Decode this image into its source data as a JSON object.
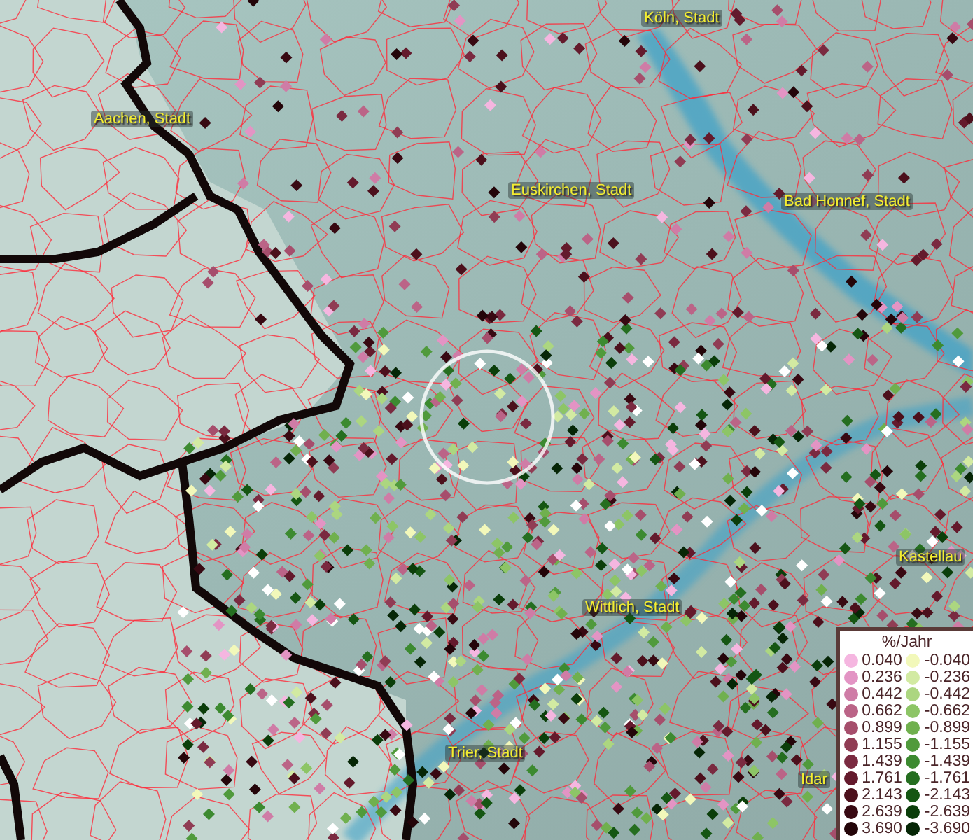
{
  "map": {
    "place_labels": [
      {
        "text": "Köln, Stadt"
      },
      {
        "text": "Aachen, Stadt"
      },
      {
        "text": "Euskirchen, Stadt"
      },
      {
        "text": "Bad Honnef, Stadt"
      },
      {
        "text": "Kastellau"
      },
      {
        "text": "Wittlich, Stadt"
      },
      {
        "text": "Trier, Stadt"
      },
      {
        "text": "Idar"
      }
    ]
  },
  "legend": {
    "title": "%/Jahr",
    "positive": [
      {
        "value": "0.040",
        "color": "#f5b6e0"
      },
      {
        "value": "0.236",
        "color": "#e394c4"
      },
      {
        "value": "0.442",
        "color": "#cf7ca6"
      },
      {
        "value": "0.662",
        "color": "#bb6487"
      },
      {
        "value": "0.899",
        "color": "#a64e6c"
      },
      {
        "value": "1.155",
        "color": "#903c54"
      },
      {
        "value": "1.439",
        "color": "#7a2a40"
      },
      {
        "value": "1.761",
        "color": "#641a2c"
      },
      {
        "value": "2.143",
        "color": "#4c101c"
      },
      {
        "value": "2.639",
        "color": "#380912"
      },
      {
        "value": "3.690",
        "color": "#240509"
      }
    ],
    "negative": [
      {
        "value": "-0.040",
        "color": "#f2f8ba"
      },
      {
        "value": "-0.236",
        "color": "#d2eaa2"
      },
      {
        "value": "-0.442",
        "color": "#acd680"
      },
      {
        "value": "-0.662",
        "color": "#8dc566"
      },
      {
        "value": "-0.899",
        "color": "#70b04e"
      },
      {
        "value": "-1.155",
        "color": "#509a3c"
      },
      {
        "value": "-1.439",
        "color": "#3c8a30"
      },
      {
        "value": "-1.761",
        "color": "#256e20"
      },
      {
        "value": "-2.143",
        "color": "#155613"
      },
      {
        "value": "-2.639",
        "color": "#0b3e0a"
      },
      {
        "value": "-3.690",
        "color": "#062606"
      }
    ]
  }
}
